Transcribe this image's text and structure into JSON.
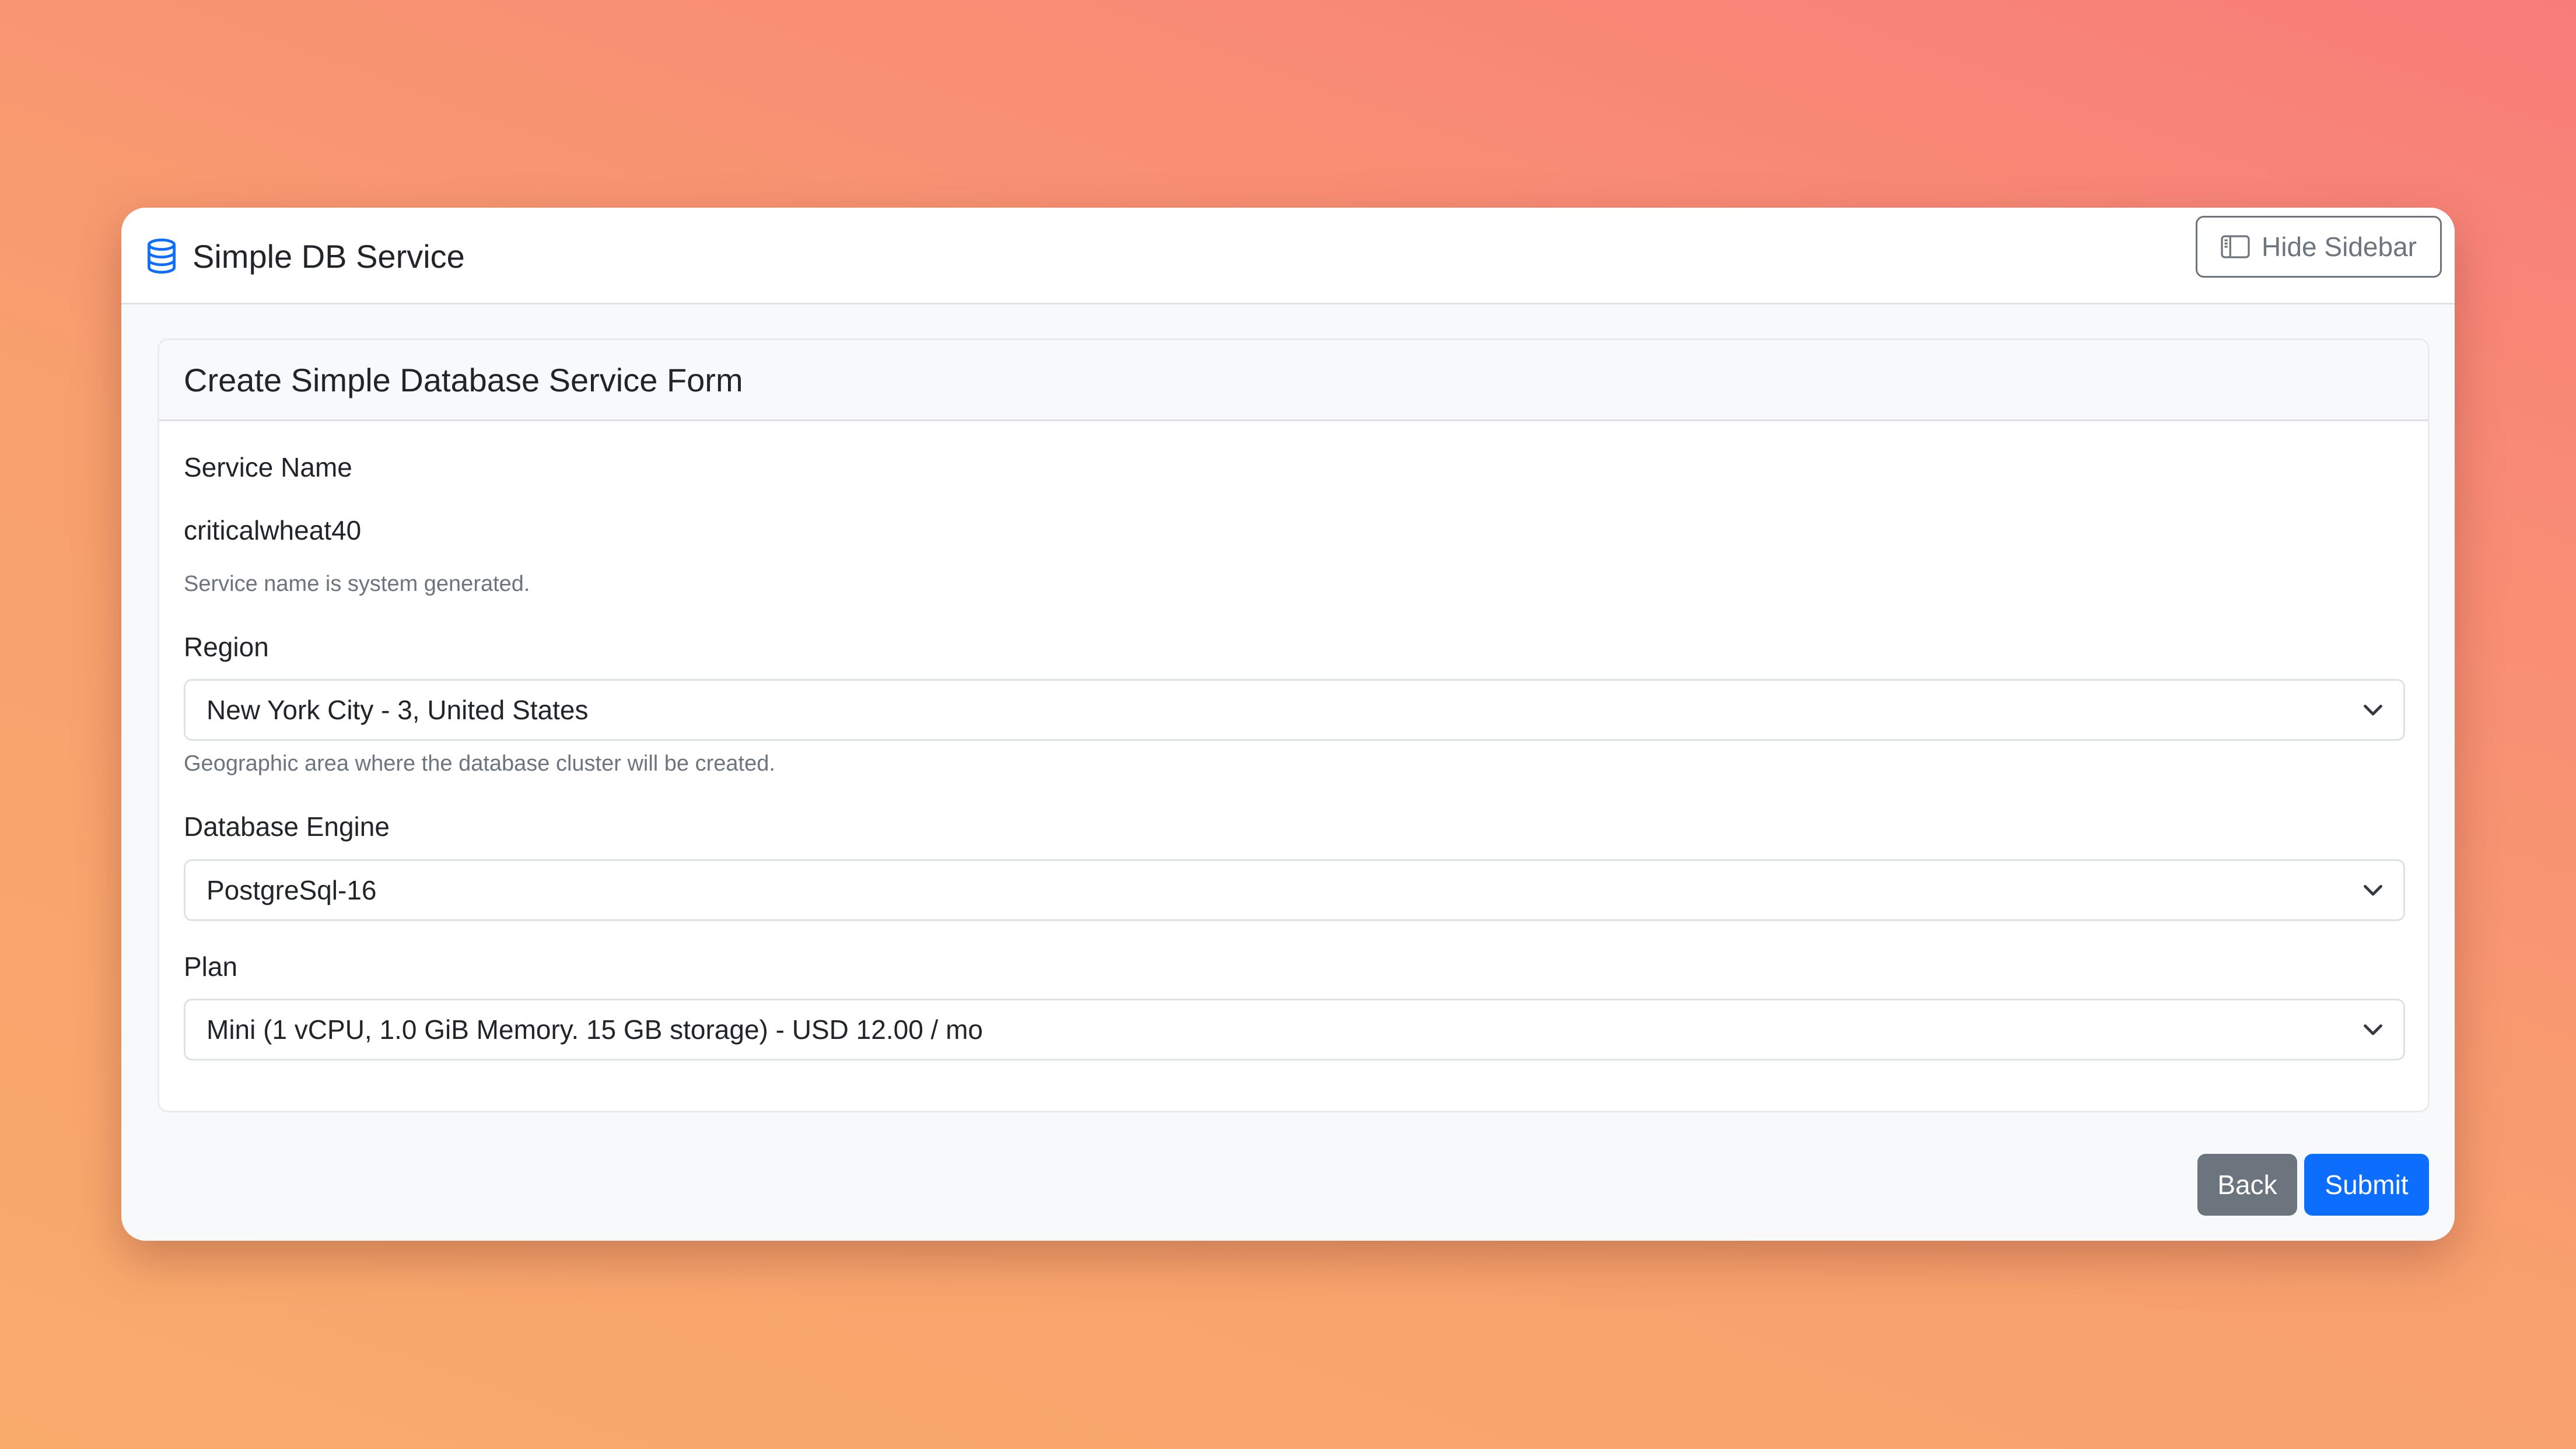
{
  "app": {
    "title": "Simple DB Service",
    "icon": "database-icon",
    "accent_color": "#0d6efd"
  },
  "toolbar": {
    "hide_sidebar_label": "Hide Sidebar",
    "hide_sidebar_icon": "sidebar-icon"
  },
  "form": {
    "title": "Create Simple Database Service Form",
    "service_name": {
      "label": "Service Name",
      "value": "criticalwheat40",
      "help": "Service name is system generated."
    },
    "region": {
      "label": "Region",
      "selected": "New York City - 3, United States",
      "help": "Geographic area where the database cluster will be created."
    },
    "engine": {
      "label": "Database Engine",
      "selected": "PostgreSql-16"
    },
    "plan": {
      "label": "Plan",
      "selected": "Mini (1 vCPU, 1.0 GiB Memory. 15 GB storage) - USD 12.00 / mo"
    }
  },
  "actions": {
    "back_label": "Back",
    "submit_label": "Submit",
    "back_color": "#6c757d",
    "submit_color": "#0d6efd"
  }
}
